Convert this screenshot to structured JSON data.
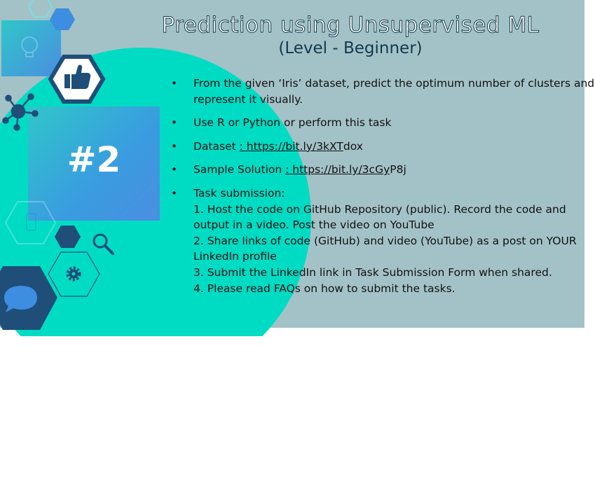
{
  "slide": {
    "title": "Prediction using Unsupervised ML",
    "subtitle": "(Level - Beginner)",
    "number": "#2",
    "bullets": {
      "b1": "From the given ‘Iris’ dataset, predict the optimum number of  clusters and represent it visually.",
      "b2": "Use R or Python or perform this task",
      "b3_label": "Dataset ",
      "b3_link": ": https://bit.ly/3kXT",
      "b3_rest": "dox",
      "b4_label": "Sample Solution ",
      "b4_link": ":  https://bit.ly/3cGy",
      "b4_rest": "P8j",
      "b5_heading": "Task submission:",
      "b5_lines": [
        "1. Host the code on GitHub Repository (public). Record the code and output in a video. Post the video on YouTube",
        "2. Share links of code (GitHub) and video (YouTube) as a post on YOUR LinkedIn profile",
        "3. Submit the LinkedIn link in Task Submission Form when shared.",
        "4. Please read FAQs on how to submit the tasks."
      ]
    }
  },
  "colors": {
    "panel": "#a3c2c7",
    "circle": "#00dcc4",
    "navy": "#1f4e79",
    "blue": "#2e86de"
  },
  "icons": [
    "thumbs-up-icon",
    "network-icon",
    "magnifier-icon",
    "gear-icon",
    "speech-bubble-icon",
    "phone-icon",
    "lightbulb-icon"
  ]
}
